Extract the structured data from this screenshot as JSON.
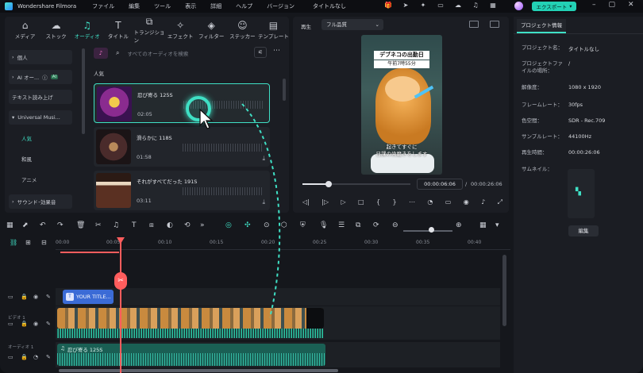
{
  "titlebar": {
    "app_name": "Wondershare Filmora",
    "menu": [
      "ファイル",
      "編集",
      "ツール",
      "表示",
      "詳細",
      "ヘルプ",
      "バージョン"
    ],
    "window_title": "タイトルなし",
    "export_label": "エクスポート"
  },
  "media_tabs": [
    {
      "label": "メディア",
      "icon": "folder-icon"
    },
    {
      "label": "ストック",
      "icon": "cloud-icon"
    },
    {
      "label": "オーディオ",
      "icon": "music-icon"
    },
    {
      "label": "タイトル",
      "icon": "text-icon"
    },
    {
      "label": "トランジション",
      "icon": "transition-icon"
    },
    {
      "label": "エフェクト",
      "icon": "effects-icon"
    },
    {
      "label": "フィルター",
      "icon": "filter-icon"
    },
    {
      "label": "ステッカー",
      "icon": "sticker-icon"
    },
    {
      "label": "テンプレート",
      "icon": "template-icon"
    }
  ],
  "sidebar": {
    "items": [
      {
        "label": "個人"
      },
      {
        "label": "AI オー...",
        "badge": "AI"
      },
      {
        "label": "テキスト読み上げ"
      },
      {
        "label": "Universal Musi..."
      },
      {
        "label": "人気"
      },
      {
        "label": "和風"
      },
      {
        "label": "アニメ"
      },
      {
        "label": "サウンド･効果音"
      }
    ]
  },
  "search": {
    "placeholder": "すべてのオーディオを検索"
  },
  "section_title": "人気",
  "tracks": [
    {
      "name": "忍び寄る 125S",
      "duration": "02:05"
    },
    {
      "name": "滑らかに 118S",
      "duration": "01:58"
    },
    {
      "name": "それがすべてだった 191S",
      "duration": "03:11"
    }
  ],
  "player": {
    "label": "再生",
    "quality": "フル品質",
    "current_time": "00:00:06:06",
    "separator": "/",
    "total_time": "00:00:26:06",
    "progress": 0.24,
    "video_title": "デブネコの出勤日",
    "video_time": "午前7時55分",
    "caption_line1": "起きてすぐに",
    "caption_line2": "日課の歯磨きをします"
  },
  "info_panel": {
    "tab": "プロジェクト情報",
    "rows": [
      {
        "label": "プロジェクト名：",
        "value": "タイトルなし"
      },
      {
        "label": "プロジェクトファイルの場所：",
        "value": "/"
      },
      {
        "label": "解像度：",
        "value": "1080 x 1920"
      },
      {
        "label": "フレームレート：",
        "value": "30fps"
      },
      {
        "label": "色空間：",
        "value": "SDR - Rec.709"
      },
      {
        "label": "サンプルレート：",
        "value": "44100Hz"
      },
      {
        "label": "再生時間：",
        "value": "00:00:26:06"
      },
      {
        "label": "サムネイル：",
        "value": ""
      }
    ],
    "edit_label": "編集"
  },
  "timeline": {
    "ruler_ticks": [
      "00:00",
      "00:05",
      "00:10",
      "00:15",
      "00:20",
      "00:25",
      "00:30",
      "00:35",
      "00:40"
    ],
    "title_clip_label": "YOUR TITLE...",
    "video_track_label": "ビデオ 1",
    "audio_track_label": "オーディオ 1",
    "audio_clip_label": "忍び寄る 125S"
  },
  "colors": {
    "accent": "#3fe0c5",
    "playhead": "#ff5d5d",
    "title_clip": "#3b6bd6"
  }
}
